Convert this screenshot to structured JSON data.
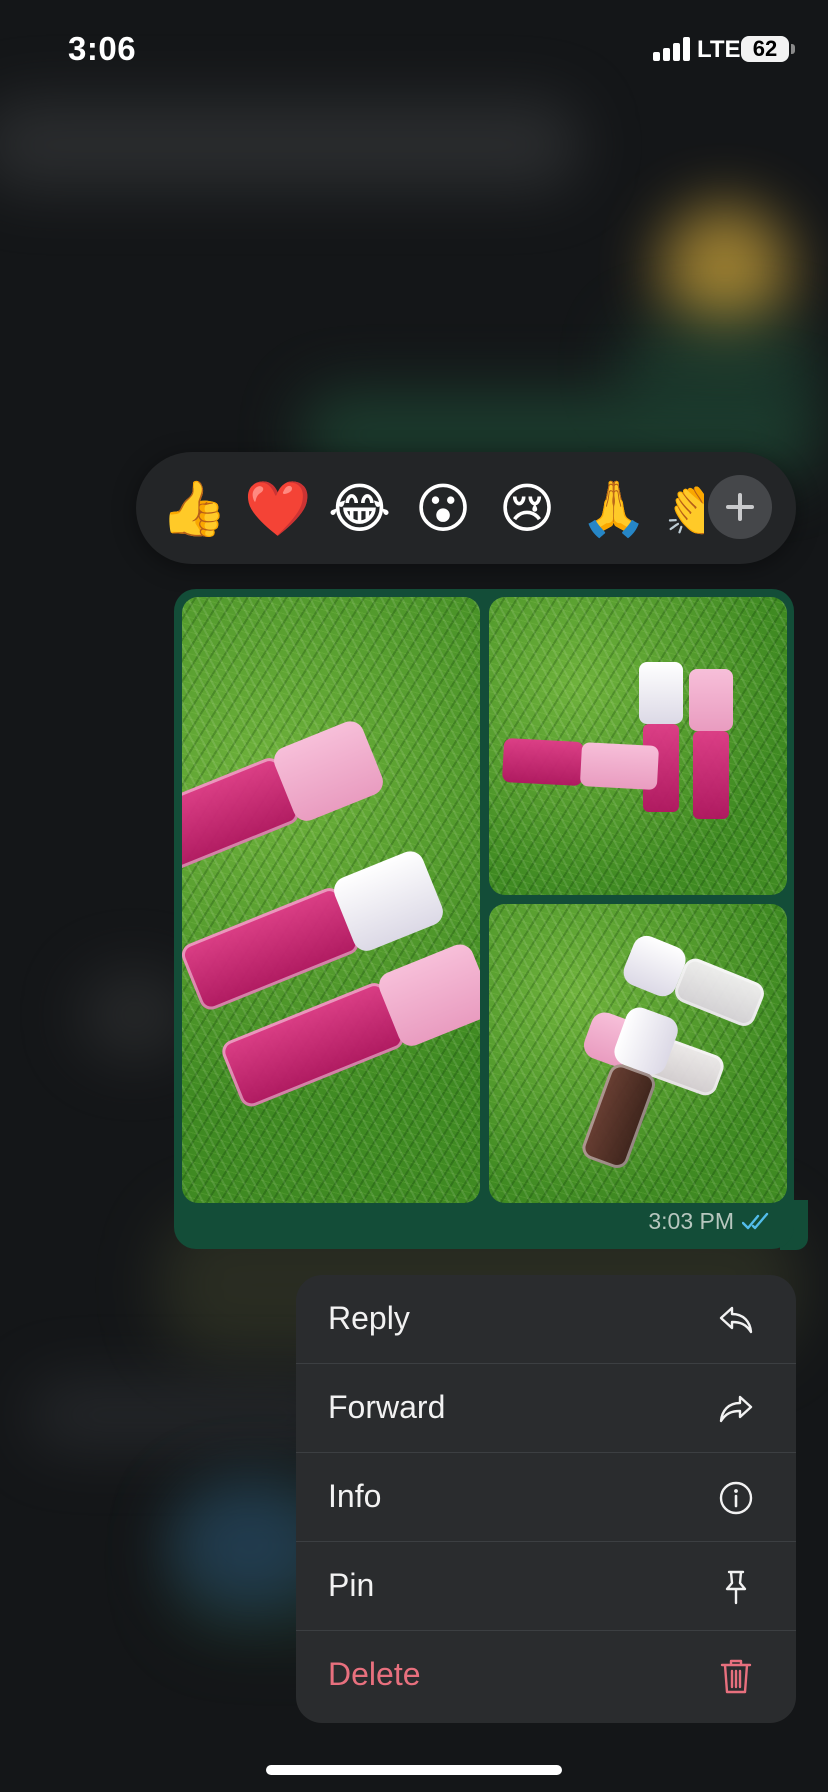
{
  "status_bar": {
    "time": "3:06",
    "network": "LTE",
    "battery": "62"
  },
  "reaction_bar": {
    "emojis": [
      {
        "name": "thumbs-up",
        "glyph": "👍"
      },
      {
        "name": "heart",
        "glyph": "❤️"
      },
      {
        "name": "laughing",
        "glyph": "😂"
      },
      {
        "name": "surprised",
        "glyph": "😮"
      },
      {
        "name": "crying",
        "glyph": "😢"
      },
      {
        "name": "praying-hands",
        "glyph": "🙏"
      },
      {
        "name": "clapping",
        "glyph": "👏"
      }
    ],
    "more_icon": "plus-icon"
  },
  "message": {
    "photos": [
      {
        "name": "lip-gloss-three-tubes"
      },
      {
        "name": "lip-gloss-standing"
      },
      {
        "name": "lip-gloss-assorted"
      }
    ],
    "time": "3:03 PM",
    "status_icon": "double-check-icon",
    "bubble_color": "#134d38"
  },
  "context_menu": {
    "items": [
      {
        "label": "Reply",
        "icon": "reply-icon"
      },
      {
        "label": "Forward",
        "icon": "forward-icon"
      },
      {
        "label": "Info",
        "icon": "info-icon"
      },
      {
        "label": "Pin",
        "icon": "pin-icon"
      },
      {
        "label": "Delete",
        "icon": "trash-icon",
        "color": "#e8707e"
      }
    ]
  }
}
